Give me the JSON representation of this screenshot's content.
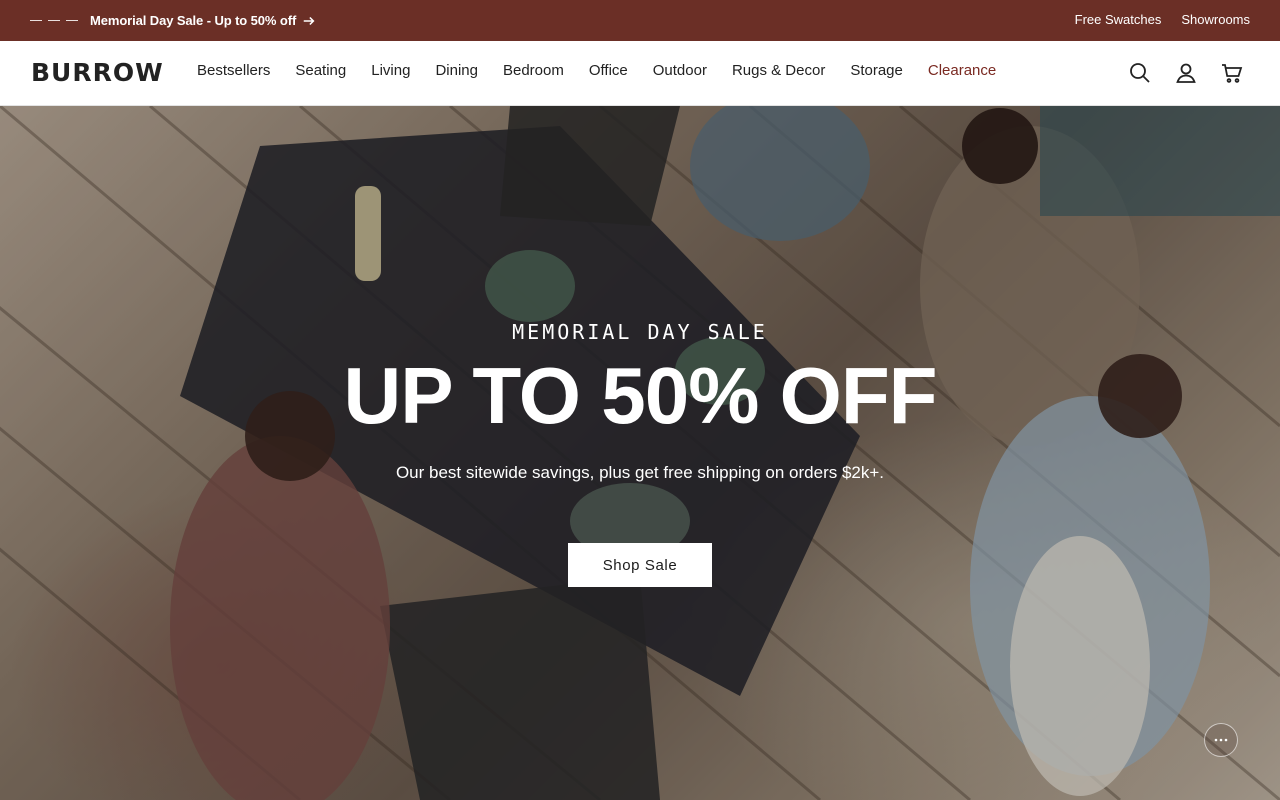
{
  "promo": {
    "message": "Memorial Day Sale - Up to 50% off",
    "links": [
      "Free Swatches",
      "Showrooms"
    ]
  },
  "header": {
    "logo": "BURROW",
    "nav": [
      "Bestsellers",
      "Seating",
      "Living",
      "Dining",
      "Bedroom",
      "Office",
      "Outdoor",
      "Rugs & Decor",
      "Storage",
      "Clearance"
    ],
    "icons": [
      "search-icon",
      "account-icon",
      "cart-icon"
    ]
  },
  "hero": {
    "eyebrow": "MEMORIAL DAY SALE",
    "headline": "UP TO 50% OFF",
    "subtext": "Our best sitewide savings, plus get free shipping on orders $2k+.",
    "cta_label": "Shop Sale",
    "chat_icon": "chat-icon"
  },
  "colors": {
    "promo_bg": "#6b2f26",
    "clearance": "#7a2a22",
    "cta_bg": "#ffffff"
  }
}
